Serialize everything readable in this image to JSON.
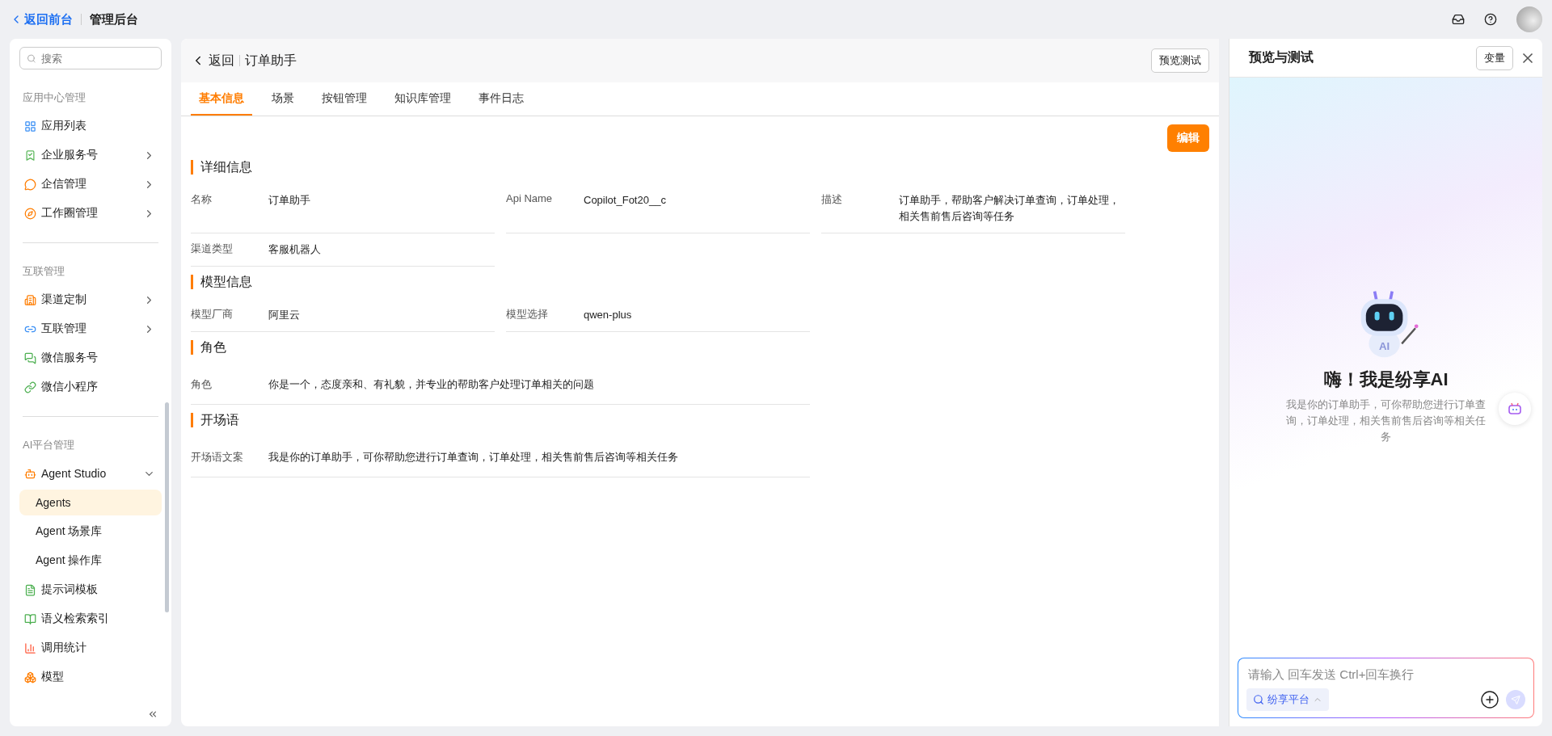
{
  "topbar": {
    "back_link": "返回前台",
    "title": "管理后台"
  },
  "sidebar": {
    "search": {
      "placeholder": "搜索"
    },
    "sections": [
      {
        "title": "应用中心管理",
        "items": [
          {
            "label": "应用列表",
            "kind": "link",
            "selected": false
          },
          {
            "label": "企业服务号",
            "kind": "group",
            "expanded": false,
            "selected": false
          },
          {
            "label": "企信管理",
            "kind": "group",
            "expanded": false,
            "selected": false
          },
          {
            "label": "工作圈管理",
            "kind": "group",
            "expanded": false,
            "selected": false
          }
        ]
      },
      {
        "title": "互联管理",
        "items": [
          {
            "label": "渠道定制",
            "kind": "group",
            "expanded": false,
            "selected": false
          },
          {
            "label": "互联管理",
            "kind": "group",
            "expanded": false,
            "selected": false
          },
          {
            "label": "微信服务号",
            "kind": "link",
            "selected": false
          },
          {
            "label": "微信小程序",
            "kind": "link",
            "selected": false
          }
        ]
      },
      {
        "title": "AI平台管理",
        "items": [
          {
            "label": "Agent Studio",
            "kind": "group",
            "expanded": true,
            "selected": false,
            "children": [
              {
                "label": "Agents",
                "selected": true
              },
              {
                "label": "Agent 场景库",
                "selected": false
              },
              {
                "label": "Agent 操作库",
                "selected": false
              }
            ]
          },
          {
            "label": "提示词模板",
            "kind": "link",
            "selected": false
          },
          {
            "label": "语义检索索引",
            "kind": "link",
            "selected": false
          },
          {
            "label": "调用统计",
            "kind": "link",
            "selected": false
          },
          {
            "label": "模型",
            "kind": "link",
            "selected": false
          }
        ]
      }
    ]
  },
  "header": {
    "back": "返回",
    "title": "订单助手",
    "preview_button": "预览测试"
  },
  "tabs": [
    {
      "label": "基本信息",
      "selected": true
    },
    {
      "label": "场景",
      "selected": false
    },
    {
      "label": "按钮管理",
      "selected": false
    },
    {
      "label": "知识库管理",
      "selected": false
    },
    {
      "label": "事件日志",
      "selected": false
    }
  ],
  "edit_button": "编辑",
  "sections": [
    {
      "title": "详细信息",
      "fields": [
        {
          "label": "名称",
          "value": "订单助手",
          "kind": "short"
        },
        {
          "label": "Api Name",
          "value": "Copilot_Fot20__c",
          "kind": "short"
        },
        {
          "label": "描述",
          "value": "订单助手，帮助客户解决订单查询，订单处理，相关售前售后咨询等任务",
          "kind": "short"
        },
        {
          "label": "渠道类型",
          "value": "客服机器人",
          "kind": "short"
        }
      ]
    },
    {
      "title": "模型信息",
      "fields": [
        {
          "label": "模型厂商",
          "value": "阿里云",
          "kind": "short"
        },
        {
          "label": "模型选择",
          "value": "qwen-plus",
          "kind": "short"
        }
      ]
    },
    {
      "title": "角色",
      "fields": [
        {
          "label": "角色",
          "value": "你是一个，态度亲和、有礼貌，并专业的帮助客户处理订单相关的问题",
          "kind": "long"
        }
      ]
    },
    {
      "title": "开场语",
      "fields": [
        {
          "label": "开场语文案",
          "value": "我是你的订单助手，可你帮助您进行订单查询，订单处理，相关售前售后咨询等相关任务",
          "kind": "long"
        }
      ]
    }
  ],
  "preview": {
    "title": "预览与测试",
    "variables_button": "变量",
    "robot_badge": "AI",
    "greeting": "嗨！我是纷享AI",
    "intro": "我是你的订单助手，可你帮助您进行订单查询，订单处理，相关售前售后咨询等相关任务",
    "input": {
      "placeholder": "请输入 回车发送 Ctrl+回车换行"
    },
    "platform_chip": "纷享平台"
  }
}
